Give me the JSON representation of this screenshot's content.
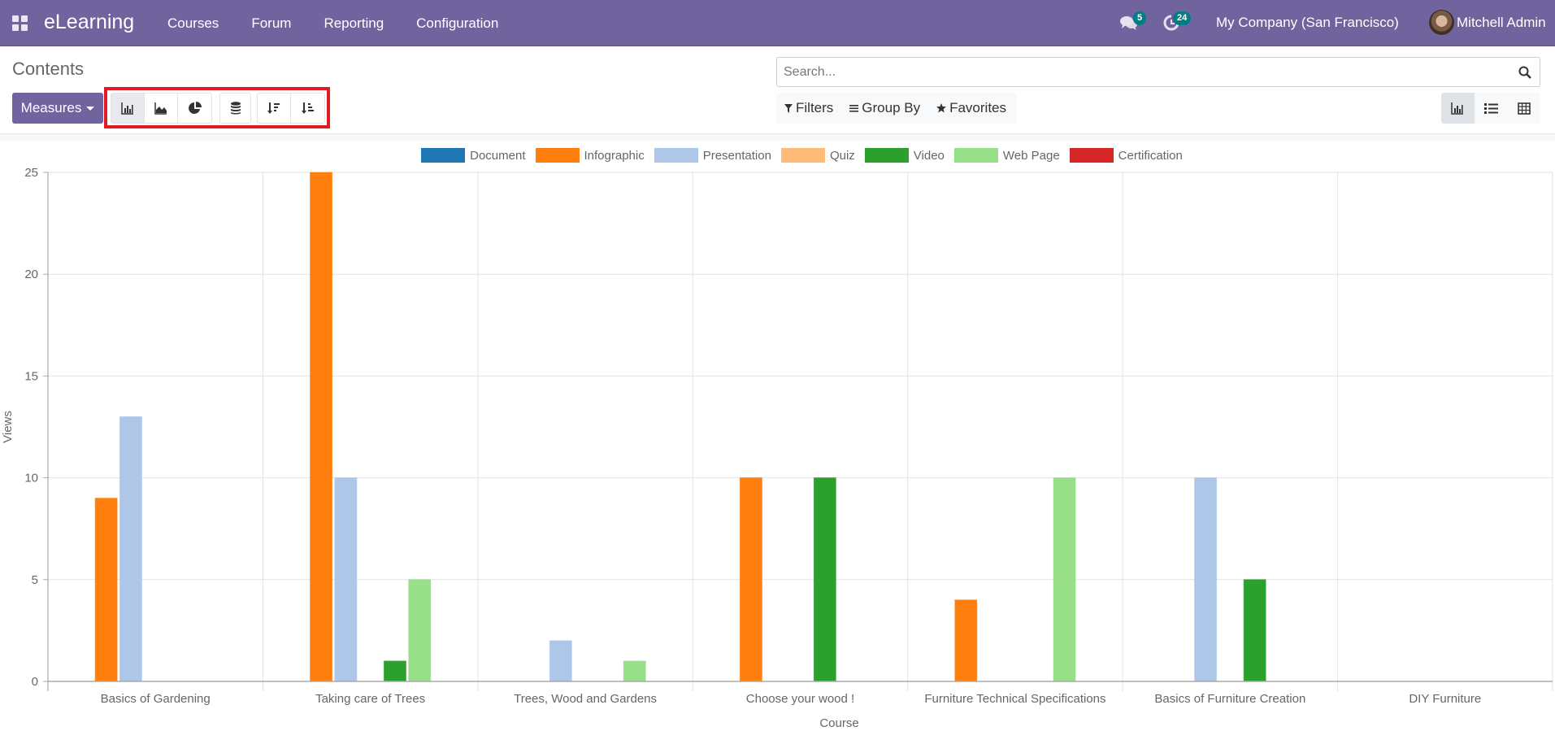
{
  "navbar": {
    "brand": "eLearning",
    "menu": [
      "Courses",
      "Forum",
      "Reporting",
      "Configuration"
    ],
    "messages_count": "5",
    "activities_count": "24",
    "company": "My Company (San Francisco)",
    "user": "Mitchell Admin",
    "color": "#71639e"
  },
  "control_panel": {
    "title": "Contents",
    "measures_label": "Measures",
    "chart_modes": [
      "bar-chart",
      "line-chart",
      "pie-chart"
    ],
    "active_mode": "bar-chart",
    "stacked": "stacked",
    "sort_buttons": [
      "sort-descending",
      "sort-ascending"
    ],
    "search_placeholder": "Search...",
    "filters_label": "Filters",
    "groupby_label": "Group By",
    "favorites_label": "Favorites",
    "views": [
      "graph",
      "list",
      "pivot"
    ],
    "active_view": "graph"
  },
  "chart_data": {
    "type": "bar",
    "title": "",
    "xlabel": "Course",
    "ylabel": "Views",
    "ylim": [
      0,
      25
    ],
    "yticks": [
      0,
      5,
      10,
      15,
      20,
      25
    ],
    "grid": true,
    "legend_position": "top-center",
    "categories": [
      "Basics of Gardening",
      "Taking care of Trees",
      "Trees, Wood and Gardens",
      "Choose your wood !",
      "Furniture Technical Specifications",
      "Basics of Furniture Creation",
      "DIY Furniture"
    ],
    "series": [
      {
        "name": "Document",
        "color": "#1f77b4",
        "values": [
          0,
          0,
          0,
          0,
          0,
          0,
          0
        ]
      },
      {
        "name": "Infographic",
        "color": "#ff7f0e",
        "values": [
          9,
          25,
          0,
          10,
          4,
          0,
          0
        ]
      },
      {
        "name": "Presentation",
        "color": "#aec7e8",
        "values": [
          13,
          10,
          2,
          0,
          0,
          10,
          0
        ]
      },
      {
        "name": "Quiz",
        "color": "#ffbb78",
        "values": [
          0,
          0,
          0,
          0,
          0,
          0,
          0
        ]
      },
      {
        "name": "Video",
        "color": "#2ca02c",
        "values": [
          0,
          1,
          0,
          10,
          0,
          5,
          0
        ]
      },
      {
        "name": "Web Page",
        "color": "#98df8a",
        "values": [
          0,
          5,
          1,
          0,
          10,
          0,
          0
        ]
      },
      {
        "name": "Certification",
        "color": "#d62728",
        "values": [
          0,
          0,
          0,
          0,
          0,
          0,
          0
        ]
      }
    ]
  }
}
